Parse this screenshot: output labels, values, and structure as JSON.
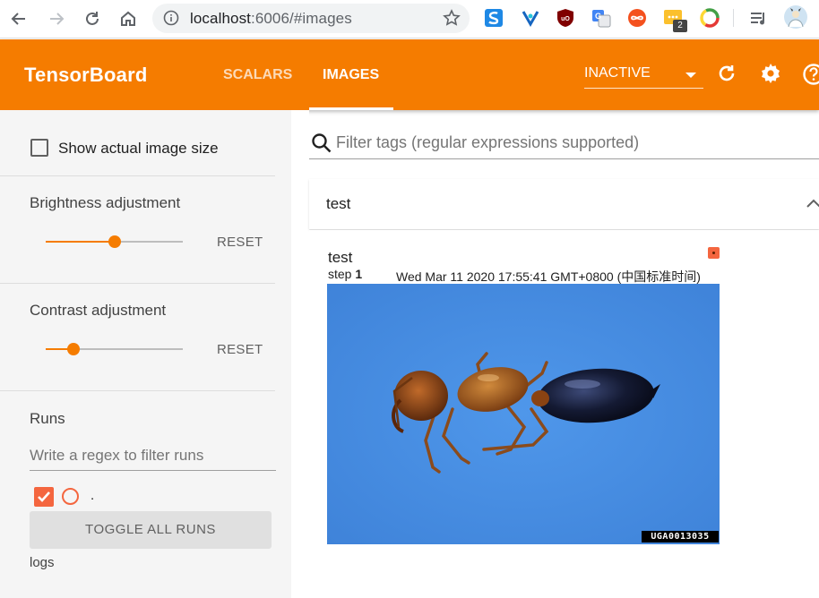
{
  "browser": {
    "url_host": "localhost",
    "url_rest": ":6006/#images",
    "extensions": [
      "sogou-icon",
      "vpn-icon",
      "ublock-icon",
      "translate-icon",
      "infinity-icon",
      "notes-icon",
      "chrome-circle-icon",
      "playlist-icon",
      "profile-avatar"
    ],
    "badge_count": "2"
  },
  "header": {
    "title": "TensorBoard",
    "tabs": [
      {
        "label": "SCALARS",
        "active": false
      },
      {
        "label": "IMAGES",
        "active": true
      }
    ],
    "run_status": "INACTIVE"
  },
  "sidebar": {
    "show_actual_size_label": "Show actual image size",
    "brightness_label": "Brightness adjustment",
    "brightness_value": 0.5,
    "contrast_label": "Contrast adjustment",
    "contrast_value": 0.2,
    "reset_label": "RESET",
    "runs_label": "Runs",
    "runs_filter_placeholder": "Write a regex to filter runs",
    "runs": [
      {
        "name": ".",
        "checked": true,
        "color": "#f4663f"
      }
    ],
    "toggle_all_label": "TOGGLE ALL RUNS",
    "logdir": "logs"
  },
  "main": {
    "filter_placeholder": "Filter tags (regular expressions supported)",
    "cards": [
      {
        "title": "test",
        "images": [
          {
            "tag": "test",
            "step_label": "step",
            "step": "1",
            "timestamp": "Wed Mar 11 2020 17:55:41 GMT+0800 (中国标准时间)",
            "watermark": "UGA0013035"
          }
        ]
      }
    ]
  },
  "colors": {
    "accent": "#f57c00",
    "run_color": "#f4663f",
    "image_bg": "#4a8de0"
  }
}
